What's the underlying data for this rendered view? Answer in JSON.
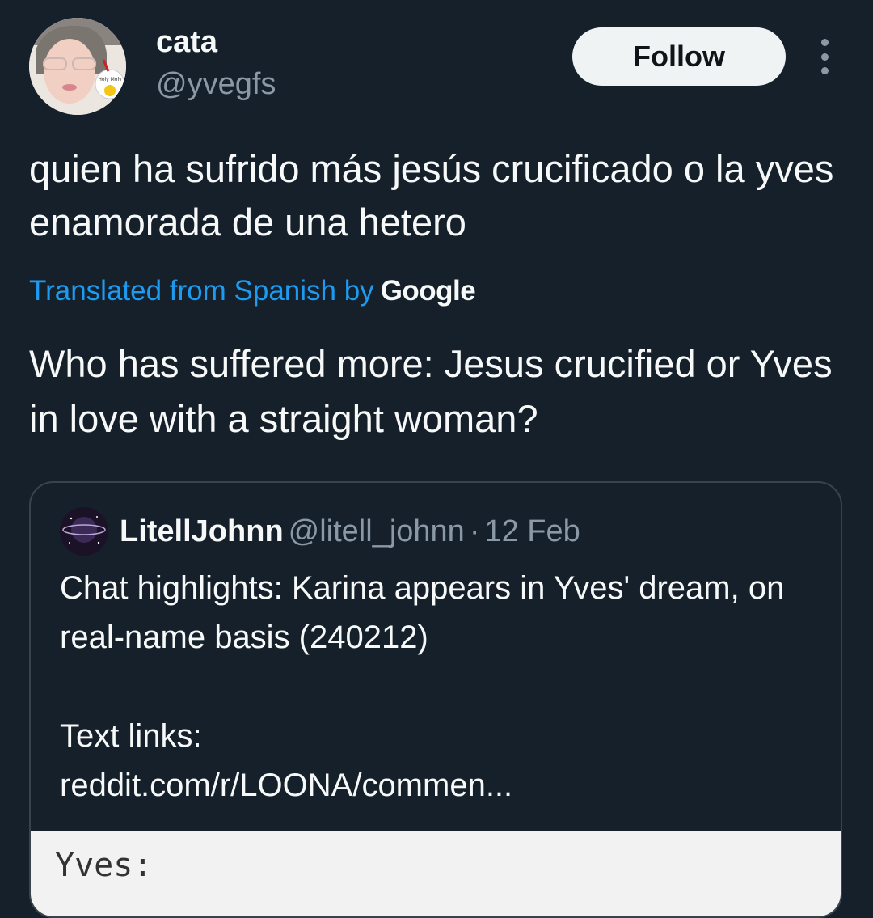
{
  "author": {
    "display_name": "cata",
    "handle": "@yvegfs",
    "avatar_sticker_text": "Holy Moly"
  },
  "follow_label": "Follow",
  "tweet": {
    "text": "quien ha sufrido más jesús crucificado o la yves enamorada de una hetero",
    "translation_label": "Translated from Spanish by",
    "translation_provider": "Google",
    "translation": "Who has suffered more: Jesus crucified or Yves in love with a straight woman?"
  },
  "quoted": {
    "name": "LitellJohnn",
    "handle": "@litell_johnn",
    "separator": "·",
    "date": "12 Feb",
    "text_line1": "Chat highlights: Karina appears in Yves' dream, on real-name basis (240212)",
    "text_line2": "Text links:",
    "text_line3": "reddit.com/r/LOONA/commen...",
    "media_text": "Yves:"
  },
  "colors": {
    "background": "#15202b",
    "primary_text": "#f7f9f9",
    "secondary_text": "#8b98a5",
    "link": "#1d9bf0",
    "border": "#38444d",
    "follow_bg": "#eff3f4"
  }
}
